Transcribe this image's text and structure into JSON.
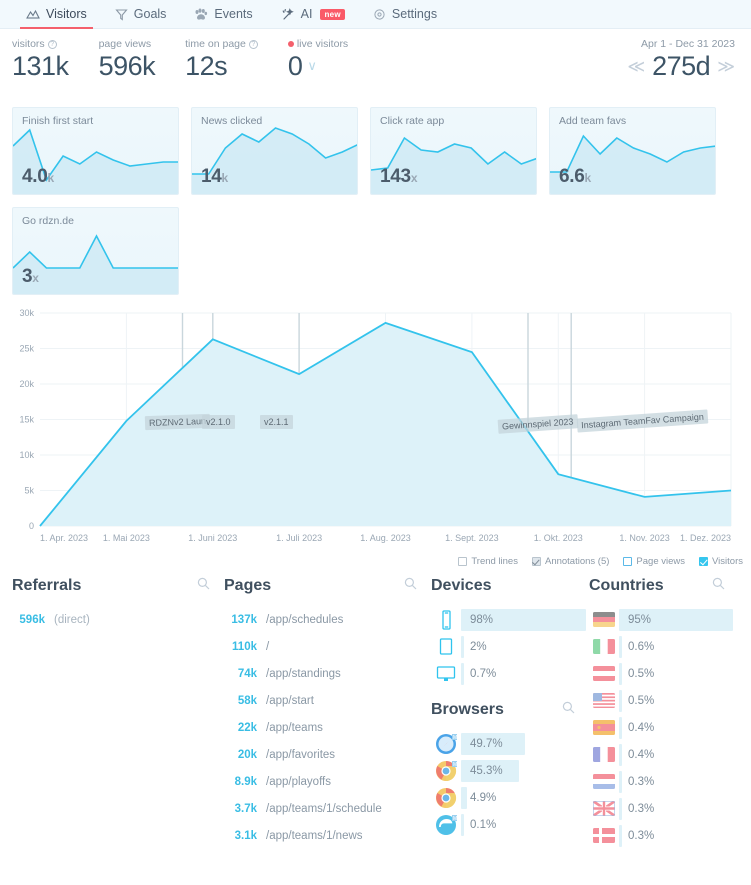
{
  "nav": {
    "tabs": [
      {
        "label": "Visitors",
        "icon": "mountains-icon",
        "active": true,
        "badge": null
      },
      {
        "label": "Goals",
        "icon": "funnel-icon",
        "active": false,
        "badge": null
      },
      {
        "label": "Events",
        "icon": "paw-icon",
        "active": false,
        "badge": null
      },
      {
        "label": "AI",
        "icon": "magic-wand-icon",
        "active": false,
        "badge": "new"
      },
      {
        "label": "Settings",
        "icon": "gear-icon",
        "active": false,
        "badge": null
      }
    ]
  },
  "kpis": [
    {
      "label": "visitors",
      "value": "131k",
      "help": true,
      "live": false
    },
    {
      "label": "page views",
      "value": "596k",
      "help": false,
      "live": false
    },
    {
      "label": "time on page",
      "value": "12s",
      "help": true,
      "live": false
    },
    {
      "label": "live visitors",
      "value": "0",
      "help": false,
      "live": true
    }
  ],
  "daterange": {
    "label": "Apr 1 - Dec 31 2023",
    "value": "275d",
    "prev": "≪",
    "next": "≫"
  },
  "cards": [
    {
      "title": "Finish first start",
      "value": "4.0",
      "unit": "k",
      "points": [
        38,
        22,
        72,
        48,
        56,
        44,
        52,
        58,
        56,
        54,
        54
      ]
    },
    {
      "title": "News clicked",
      "value": "14",
      "unit": "k",
      "points": [
        66,
        66,
        40,
        26,
        34,
        20,
        26,
        36,
        50,
        44,
        36
      ]
    },
    {
      "title": "Click rate app",
      "value": "143",
      "unit": "x",
      "points": [
        62,
        60,
        30,
        42,
        44,
        36,
        40,
        56,
        44,
        56,
        50
      ]
    },
    {
      "title": "Add team favs",
      "value": "6.6",
      "unit": "k",
      "points": [
        64,
        64,
        28,
        46,
        30,
        40,
        46,
        54,
        44,
        40,
        38
      ]
    },
    {
      "title": "Go rdzn.de",
      "value": "3",
      "unit": "x",
      "points": [
        60,
        44,
        60,
        60,
        60,
        28,
        60,
        60,
        60,
        60,
        60
      ]
    }
  ],
  "chart_data": {
    "type": "area",
    "title": "",
    "xlabel": "",
    "ylabel": "",
    "ylim": [
      0,
      30000
    ],
    "yticks": [
      0,
      5000,
      10000,
      15000,
      20000,
      25000,
      30000
    ],
    "yticklabels": [
      "0",
      "5k",
      "10k",
      "15k",
      "20k",
      "25k",
      "30k"
    ],
    "x": [
      "1. Apr. 2023",
      "1. Mai 2023",
      "1. Juni 2023",
      "1. Juli 2023",
      "1. Aug. 2023",
      "1. Sept. 2023",
      "1. Okt. 2023",
      "1. Nov. 2023",
      "1. Dez. 2023"
    ],
    "xticklabels": [
      "1. Apr. 2023",
      "1. Mai 2023",
      "1. Juni 2023",
      "1. Juli 2023",
      "1. Aug. 2023",
      "1. Sept. 2023",
      "1. Okt. 2023",
      "1. Nov. 2023",
      "1. Dez. 2023"
    ],
    "grid": true,
    "legend_position": "bottom-right",
    "series": [
      {
        "name": "Visitors",
        "color": "#33c3ec",
        "values": [
          0,
          14800,
          26300,
          21400,
          28600,
          24500,
          7300,
          4100,
          5000
        ]
      }
    ],
    "annotations": [
      {
        "label": "RDZNv2 Laun",
        "x": "2023-05-20"
      },
      {
        "label": "v2.1.0",
        "x": "2023-06-01"
      },
      {
        "label": "v2.1.1",
        "x": "2023-07-01"
      },
      {
        "label": "Gewinnspiel 2023",
        "x": "2023-09-20"
      },
      {
        "label": "Instagram TeamFav Campaign",
        "x": "2023-10-05"
      }
    ]
  },
  "legend": [
    {
      "label": "Trend lines",
      "checked": false,
      "style": "unchecked-grey"
    },
    {
      "label": "Annotations (5)",
      "checked": true,
      "style": "checked-grey"
    },
    {
      "label": "Page views",
      "checked": false,
      "style": "unchecked-blue"
    },
    {
      "label": "Visitors",
      "checked": true,
      "style": "checked-cyan"
    }
  ],
  "panels": {
    "referrals": {
      "title": "Referrals",
      "rows": [
        {
          "num": "596k",
          "text": "(direct)"
        }
      ]
    },
    "pages": {
      "title": "Pages",
      "rows": [
        {
          "num": "137k",
          "text": "/app/schedules"
        },
        {
          "num": "110k",
          "text": "/"
        },
        {
          "num": "74k",
          "text": "/app/standings"
        },
        {
          "num": "58k",
          "text": "/app/start"
        },
        {
          "num": "22k",
          "text": "/app/teams"
        },
        {
          "num": "20k",
          "text": "/app/favorites"
        },
        {
          "num": "8.9k",
          "text": "/app/playoffs"
        },
        {
          "num": "3.7k",
          "text": "/app/teams/1/schedule"
        },
        {
          "num": "3.1k",
          "text": "/app/teams/1/news"
        }
      ]
    },
    "devices": {
      "title": "Devices",
      "rows": [
        {
          "icon": "phone-icon",
          "label": "98%",
          "pct": 98
        },
        {
          "icon": "tablet-icon",
          "label": "2%",
          "pct": 2
        },
        {
          "icon": "desktop-icon",
          "label": "0.7%",
          "pct": 0.7
        }
      ]
    },
    "browsers": {
      "title": "Browsers",
      "rows": [
        {
          "icon": "safari-icon",
          "label": "49.7%",
          "pct": 49.7
        },
        {
          "icon": "chrome-icon",
          "label": "45.3%",
          "pct": 45.3
        },
        {
          "icon": "chrome-mobile-icon",
          "label": "4.9%",
          "pct": 4.9
        },
        {
          "icon": "edge-icon",
          "label": "0.1%",
          "pct": 0.1
        }
      ]
    },
    "countries": {
      "title": "Countries",
      "rows": [
        {
          "icon": "flag-de",
          "label": "95%",
          "pct": 95
        },
        {
          "icon": "flag-it",
          "label": "0.6%",
          "pct": 0.6
        },
        {
          "icon": "flag-at",
          "label": "0.5%",
          "pct": 0.5
        },
        {
          "icon": "flag-us",
          "label": "0.5%",
          "pct": 0.5
        },
        {
          "icon": "flag-es",
          "label": "0.4%",
          "pct": 0.4
        },
        {
          "icon": "flag-fr",
          "label": "0.4%",
          "pct": 0.4
        },
        {
          "icon": "flag-nl",
          "label": "0.3%",
          "pct": 0.3
        },
        {
          "icon": "flag-gb",
          "label": "0.3%",
          "pct": 0.3
        },
        {
          "icon": "flag-dk",
          "label": "0.3%",
          "pct": 0.3
        }
      ]
    }
  },
  "icons": {
    "search": "search-icon"
  },
  "colors": {
    "accent": "#33c3ec",
    "area_fill": "#ddf2f9",
    "active_tab_underline": "#f4606c",
    "badge_new": "#fa5a68",
    "num_blue": "#39bde4"
  }
}
